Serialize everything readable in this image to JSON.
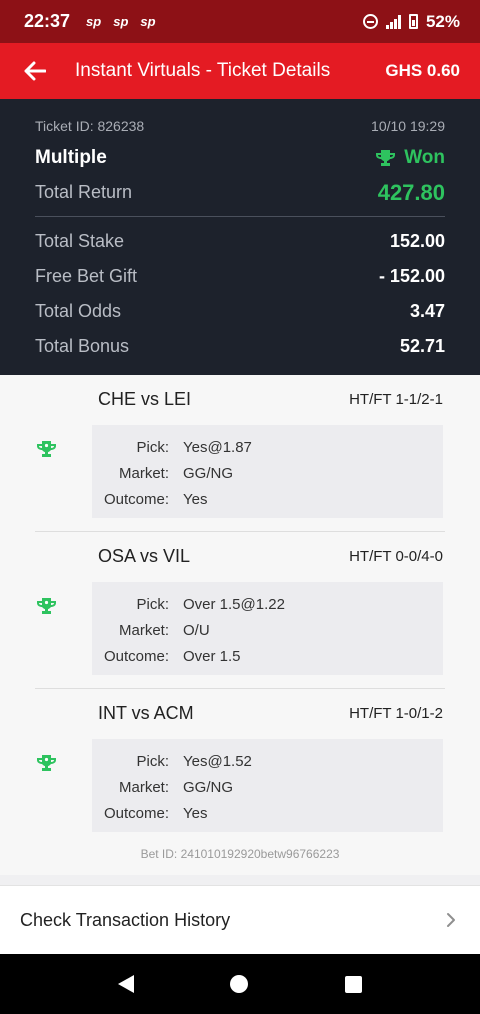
{
  "status_bar": {
    "time": "22:37",
    "notification_icons": [
      "sp",
      "sp",
      "sp"
    ],
    "battery_percent": "52%",
    "icons": [
      "dnd-icon",
      "wifi-calling-icon",
      "signal-icon",
      "battery-icon"
    ]
  },
  "app_bar": {
    "title": "Instant Virtuals - Ticket Details",
    "balance": "GHS 0.60",
    "back_icon": "arrow-left-icon"
  },
  "ticket": {
    "id_label": "Ticket ID: 826238",
    "datetime": "10/10 19:29",
    "type": "Multiple",
    "status": "Won",
    "total_return_label": "Total Return",
    "total_return": "427.80",
    "total_stake_label": "Total Stake",
    "total_stake": "152.00",
    "free_bet_label": "Free Bet Gift",
    "free_bet": "- 152.00",
    "total_odds_label": "Total Odds",
    "total_odds": "3.47",
    "total_bonus_label": "Total Bonus",
    "total_bonus": "52.71"
  },
  "labels": {
    "pick": "Pick:",
    "market": "Market:",
    "outcome": "Outcome:"
  },
  "bets": [
    {
      "match": "CHE vs LEI",
      "htft": "HT/FT 1-1/2-1",
      "pick": "Yes@1.87",
      "market": "GG/NG",
      "outcome": "Yes",
      "result_icon": "trophy-icon"
    },
    {
      "match": "OSA vs VIL",
      "htft": "HT/FT 0-0/4-0",
      "pick": "Over 1.5@1.22",
      "market": "O/U",
      "outcome": "Over 1.5",
      "result_icon": "trophy-icon"
    },
    {
      "match": "INT vs ACM",
      "htft": "HT/FT 1-0/1-2",
      "pick": "Yes@1.52",
      "market": "GG/NG",
      "outcome": "Yes",
      "result_icon": "trophy-icon"
    }
  ],
  "bet_id": "Bet ID: 241010192920betw96766223",
  "footer": {
    "history_label": "Check Transaction History"
  },
  "colors": {
    "status_bar": "#8d1116",
    "app_bar": "#e41b23",
    "summary_bg": "#1d222c",
    "won_green": "#2ec35f"
  }
}
